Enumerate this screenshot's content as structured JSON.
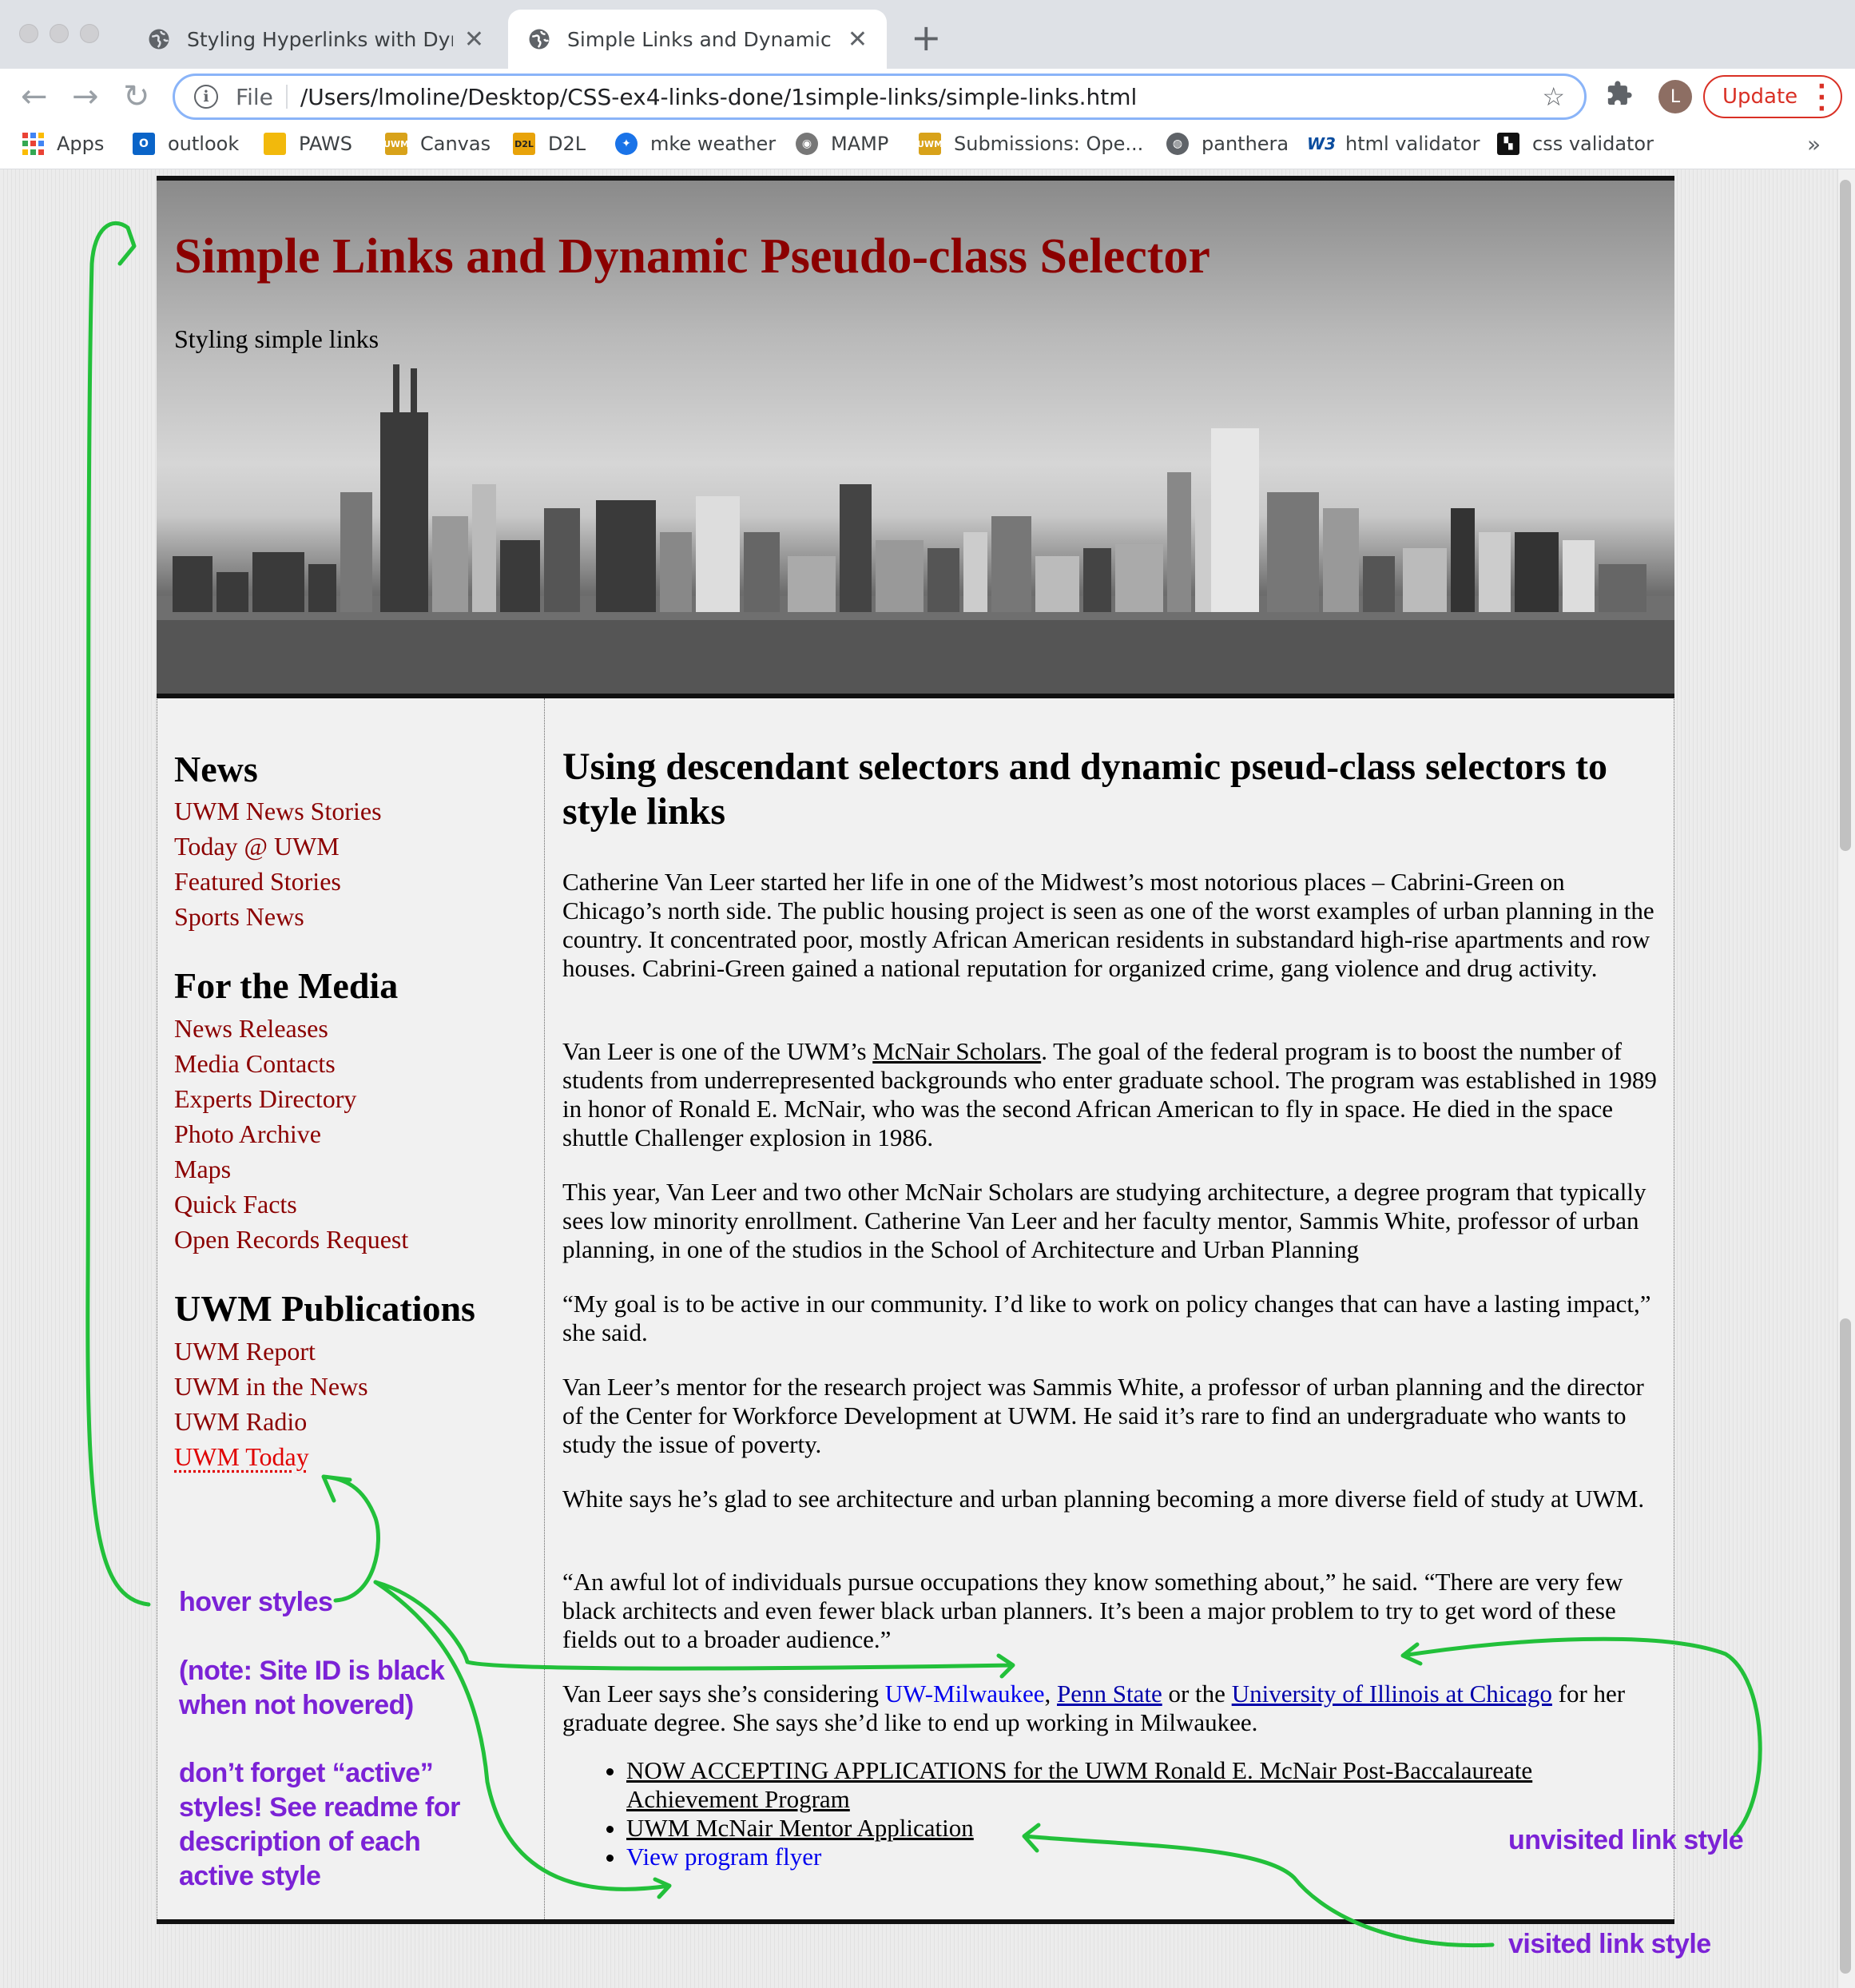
{
  "browser": {
    "tabs": [
      {
        "title": "Styling Hyperlinks with Dynami",
        "active": false
      },
      {
        "title": "Simple Links and Dynamic Pseu",
        "active": true
      }
    ],
    "new_tab": "+",
    "close_glyph": "✕",
    "protocol": "File",
    "url": "/Users/lmoline/Desktop/CSS-ex4-links-done/1simple-links/simple-links.html",
    "avatar_letter": "L",
    "update_label": "Update",
    "bookmarks": [
      {
        "label": "Apps",
        "icon": "apps-grid-icon"
      },
      {
        "label": "outlook",
        "icon": "outlook-icon"
      },
      {
        "label": "PAWS",
        "icon": "paws-icon"
      },
      {
        "label": "Canvas",
        "icon": "uwm-icon"
      },
      {
        "label": "D2L",
        "icon": "d2l-icon"
      },
      {
        "label": "mke weather",
        "icon": "weather-icon"
      },
      {
        "label": "MAMP",
        "icon": "mamp-icon"
      },
      {
        "label": "Submissions: Ope...",
        "icon": "uwm-icon"
      },
      {
        "label": "panthera",
        "icon": "globe-icon"
      },
      {
        "label": "html validator",
        "icon": "w3c-icon"
      },
      {
        "label": "css validator",
        "icon": "css-validator-icon"
      }
    ],
    "more_bookmarks": "»"
  },
  "header": {
    "title": "Simple Links and Dynamic Pseudo-class Selector",
    "tagline": "Styling simple links"
  },
  "sidebar": {
    "sections": [
      {
        "heading": "News",
        "links": [
          "UWM News Stories",
          "Today @ UWM",
          "Featured Stories",
          "Sports News"
        ]
      },
      {
        "heading": "For the Media",
        "links": [
          "News Releases",
          "Media Contacts",
          "Experts Directory",
          "Photo Archive",
          "Maps",
          "Quick Facts",
          "Open Records Request"
        ]
      },
      {
        "heading": "UWM Publications",
        "links": [
          "UWM Report",
          "UWM in the News",
          "UWM Radio",
          "UWM Today"
        ]
      }
    ]
  },
  "main": {
    "heading": "Using descendant selectors and dynamic pseud-class selectors to style links",
    "p1": "Catherine Van Leer started her life in one of the Midwest’s most notorious places – Cabrini-Green on Chicago’s north side. The public housing project is seen as one of the worst examples of urban planning in the country. It concentrated poor, mostly African American residents in substandard high-rise apartments and row houses. Cabrini-Green gained a national reputation for organized crime, gang violence and drug activity.",
    "p2_before": "Van Leer is one of the UWM’s ",
    "p2_link": "McNair Scholars",
    "p2_after": ". The goal of the federal program is to boost the number of students from underrepresented backgrounds who enter graduate school. The program was established in 1989 in honor of Ronald E. McNair, who was the second African American to fly in space. He died in the space shuttle Challenger explosion in 1986.",
    "p3": "This year, Van Leer and two other McNair Scholars are studying architecture, a degree program that typically sees low minority enrollment. Catherine Van Leer and her faculty mentor, Sammis White, professor of urban planning, in one of the studios in the School of Architecture and Urban Planning",
    "p4": "“My goal is to be active in our community. I’d like to work on policy changes that can have a lasting impact,” she said.",
    "p5": "Van Leer’s mentor for the research project was Sammis White, a professor of urban planning and the director of the Center for Workforce Development at UWM. He said it’s rare to find an undergraduate who wants to study the issue of poverty.",
    "p6": "White says he’s glad to see architecture and urban planning becoming a more diverse field of study at UWM.",
    "p7": "“An awful lot of individuals pursue occupations they know something about,” he said. “There are very few black architects and even fewer black urban planners. It’s been a major problem to try to get word of these fields out to a broader audience.”",
    "p8_before": "Van Leer says she’s considering ",
    "p8_link1": "UW-Milwaukee",
    "p8_comma": ", ",
    "p8_link2": "Penn State",
    "p8_mid": " or the ",
    "p8_link3": "University of Illinois at Chicago",
    "p8_after": " for her graduate degree. She says she’d like to end up working in Milwaukee.",
    "list": [
      "NOW ACCEPTING APPLICATIONS for the UWM Ronald E. McNair Post-Baccalaureate Achievement Program",
      "UWM McNair Mentor Application",
      "View program flyer"
    ]
  },
  "annotations": {
    "hover": "hover styles",
    "note": "(note: Site ID is black when not hovered)",
    "active": "don’t forget “active” styles! See readme for description of each active style",
    "unvisited": "unvisited link style",
    "visited": "visited link style"
  },
  "colors": {
    "site_title": "#8b0000",
    "sidebar_link": "#8b0000",
    "sidebar_hover": "#e00000",
    "unvisited_link": "#0000ee",
    "visited_link": "#000000",
    "annotation_text": "#7b22d6",
    "annotation_arrow": "#22c03a"
  }
}
